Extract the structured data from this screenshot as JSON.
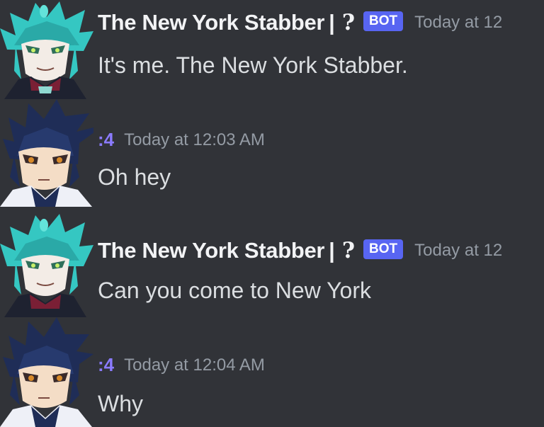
{
  "messages": [
    {
      "author": "The New York Stabber",
      "separator": "|",
      "decoration": "?",
      "badge": "BOT",
      "timestamp": "Today at 12",
      "text": "It's me. The New York Stabber.",
      "avatar": "cyan-hair-avatar-icon"
    },
    {
      "author": ":4",
      "timestamp": "Today at 12:03 AM",
      "text": "Oh hey",
      "avatar": "navy-hair-avatar-icon"
    },
    {
      "author": "The New York Stabber",
      "separator": "|",
      "decoration": "?",
      "badge": "BOT",
      "timestamp": "Today at 12",
      "text": "Can you come to New York",
      "avatar": "cyan-hair-avatar-icon"
    },
    {
      "author": ":4",
      "timestamp": "Today at 12:04 AM",
      "text": "Why",
      "avatar": "navy-hair-avatar-icon"
    }
  ],
  "colors": {
    "background": "#313338",
    "username": "#f2f3f5",
    "user_id_accent": "#8b7bff",
    "bot_badge": "#5865f2",
    "timestamp": "#949ba4",
    "message_text": "#dbdee1"
  }
}
